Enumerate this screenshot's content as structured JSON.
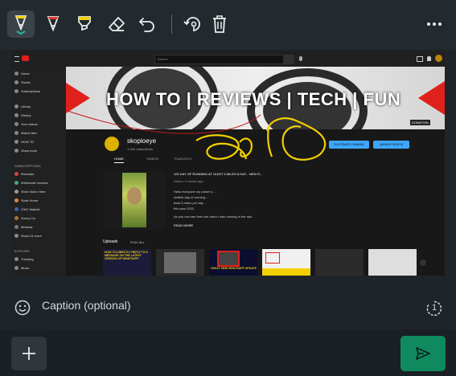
{
  "toolbar": {
    "tools": [
      {
        "name": "pen-tool",
        "icon": "pen-icon"
      },
      {
        "name": "marker-red",
        "icon": "marker-icon",
        "color": "#e53935"
      },
      {
        "name": "highlighter-yellow",
        "icon": "highlighter-icon",
        "color": "#f5d000"
      },
      {
        "name": "eraser",
        "icon": "eraser-icon"
      },
      {
        "name": "undo",
        "icon": "undo-icon"
      },
      {
        "name": "rotate",
        "icon": "rotate-icon"
      },
      {
        "name": "delete",
        "icon": "trash-icon"
      },
      {
        "name": "more",
        "icon": "more-icon"
      }
    ],
    "active_color": "#2ab7a9"
  },
  "youtube": {
    "search_placeholder": "Search",
    "sidebar": [
      "Home",
      "Shorts",
      "Subscriptions",
      "Library",
      "History",
      "Your videos",
      "Watch later",
      "HOW TO",
      "Show more"
    ],
    "subscriptions_heading": "SUBSCRIPTIONS",
    "subscriptions": [
      "Ricecake",
      "Wholesale Investor",
      "Short Video Here",
      "Solar Home",
      "CWC Malkoti",
      "Sunny Liu",
      "Mrbeast",
      "Show 24 more"
    ],
    "explore_heading": "EXPLORE",
    "explore": [
      "Trending",
      "Music"
    ],
    "banner_text": "HOW TO | REVIEWS | TECH | FUN",
    "donation_label": "DONATION",
    "channel_name": "skopioeye",
    "subscriber_count": "1.25K subscribers",
    "customize_button": "CUSTOMIZE CHANNEL",
    "manage_button": "MANAGE VIDEOS",
    "tabs": [
      "HOME",
      "VIDEOS",
      "PLAYLISTS"
    ],
    "video_title": "100 DAY OF RUNNING AT LEAST 5 MILES A DAY - NEW R...",
    "video_views": "Views • 2 weeks ago",
    "video_desc_lines": [
      "Hello everyone my name is ...",
      "sixtieth day of running ...",
      "least 5 miles per day ...",
      "this year 2022."
    ],
    "video_desc_extra": "As you can see from the video I was running in the rain.",
    "read_more": "READ MORE",
    "uploads_label": "Uploads",
    "play_all": "PLAY ALL",
    "thumb1_text": "HOW TO DIRECTLY REPLY TO A MESSAGE ON THE LATEST VERSION OF WHATSAPP",
    "thumb2_text": "CRAZY NEW WHATSAPP UPDATE",
    "colors": {
      "banner_red": "#e0201c",
      "annotation_yellow": "#f5d000",
      "send_green": "#0f8a5f"
    }
  },
  "caption": {
    "placeholder": "Caption (optional)",
    "timer_label": "1"
  },
  "bottom": {
    "add_icon": "plus-icon",
    "send_icon": "send-icon"
  }
}
